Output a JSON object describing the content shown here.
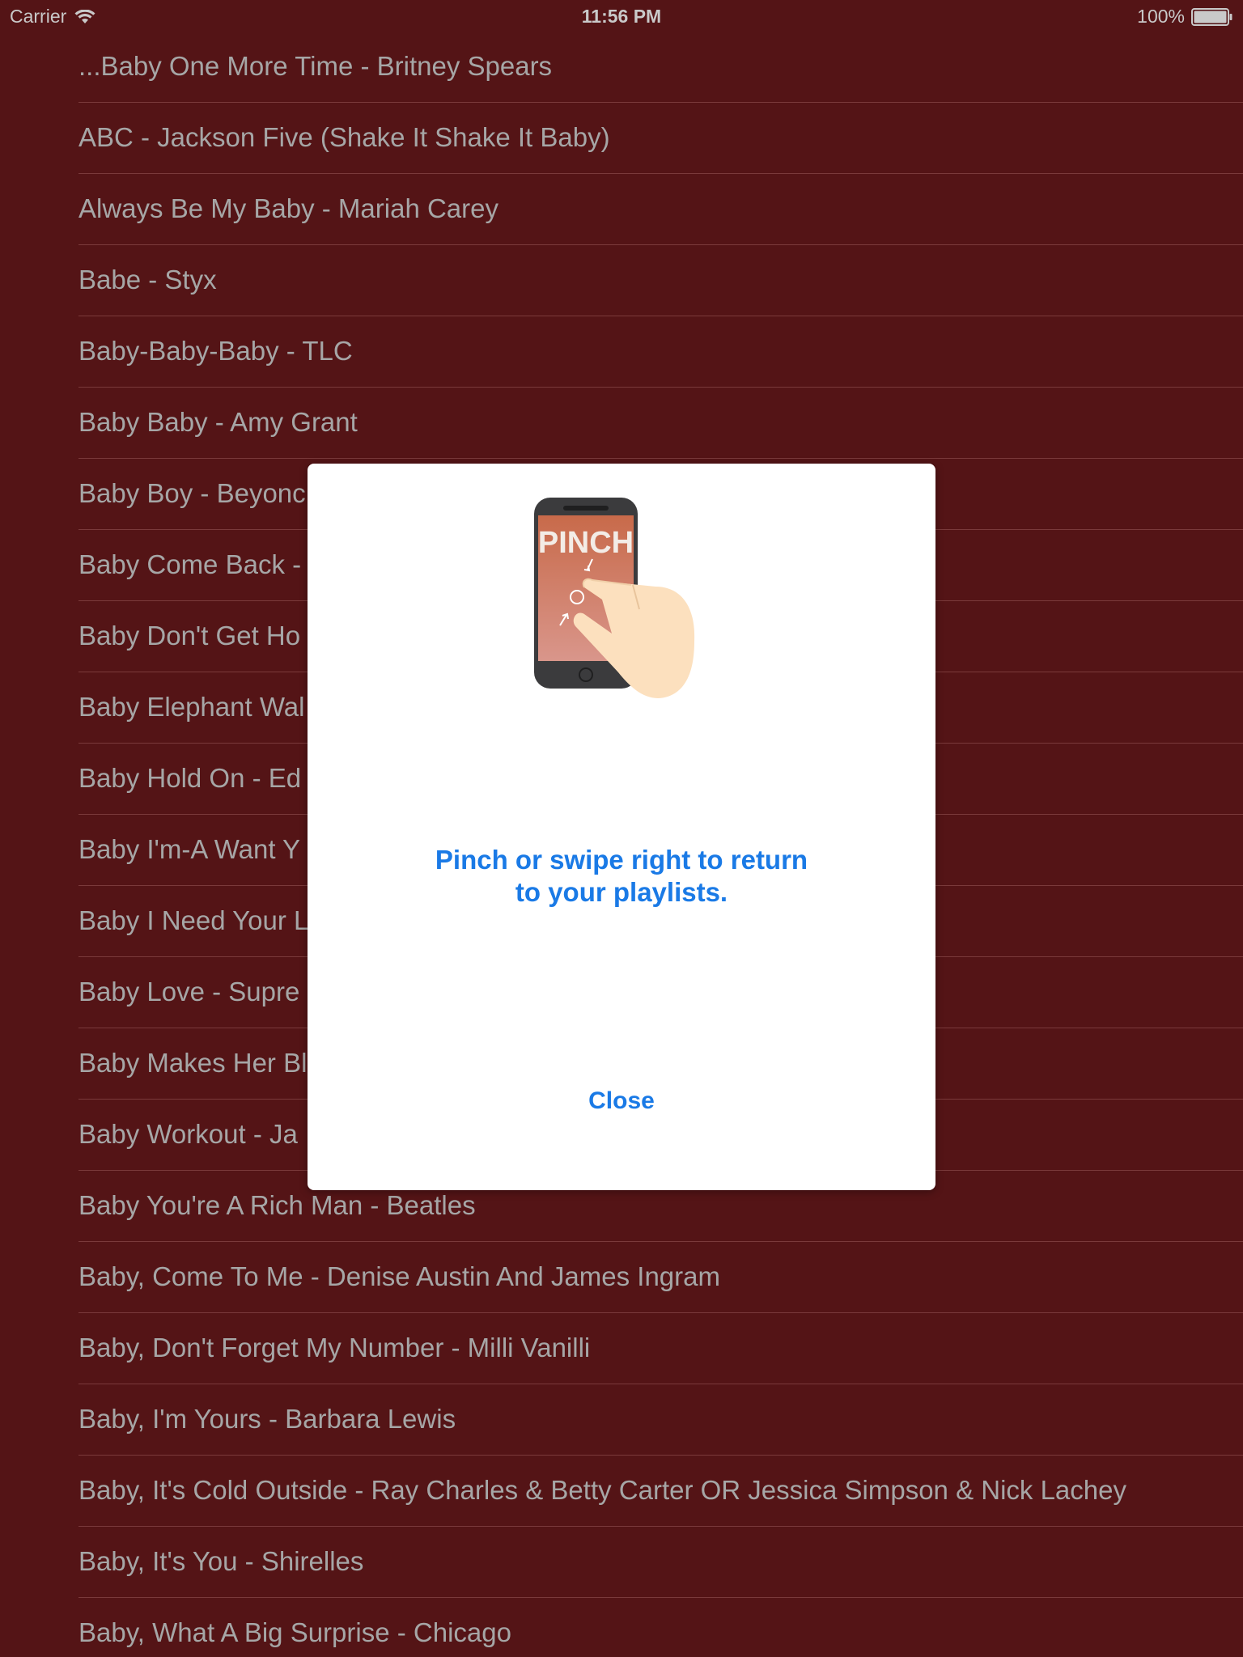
{
  "status_bar": {
    "carrier": "Carrier",
    "time": "11:56 PM",
    "battery": "100%"
  },
  "songs": [
    "...Baby One More Time - Britney Spears",
    "ABC - Jackson Five (Shake It Shake It Baby)",
    "Always Be My Baby - Mariah Carey",
    "Babe - Styx",
    "Baby-Baby-Baby - TLC",
    "Baby Baby - Amy Grant",
    "Baby Boy - Beyonc",
    "Baby Come Back -",
    "Baby Don't Get Ho",
    "Baby Elephant Wal",
    "Baby Hold On - Ed",
    "Baby I'm-A Want Y",
    "Baby I Need Your L",
    "Baby Love - Supre",
    "Baby Makes Her Bl",
    "Baby Workout - Ja",
    "Baby You're A Rich Man - Beatles",
    "Baby, Come To Me - Denise Austin And James Ingram",
    "Baby, Don't Forget My Number - Milli Vanilli",
    "Baby, I'm Yours - Barbara Lewis",
    "Baby, It's Cold Outside - Ray Charles & Betty Carter OR Jessica Simpson & Nick Lachey",
    "Baby, It's You - Shirelles",
    "Baby, What A Big Surprise - Chicago"
  ],
  "modal": {
    "illustration_text": "PINCH",
    "message_line1": "Pinch or swipe right to return",
    "message_line2": "to your playlists.",
    "close_label": "Close"
  },
  "colors": {
    "background": "#541416",
    "list_text": "#a6a6a6",
    "separator": "#7a3a3b",
    "accent": "#1a7ae6",
    "modal_bg": "#ffffff"
  },
  "icons": {
    "wifi": "wifi-icon",
    "battery": "battery-icon",
    "illustration": "pinch-gesture-illustration"
  }
}
